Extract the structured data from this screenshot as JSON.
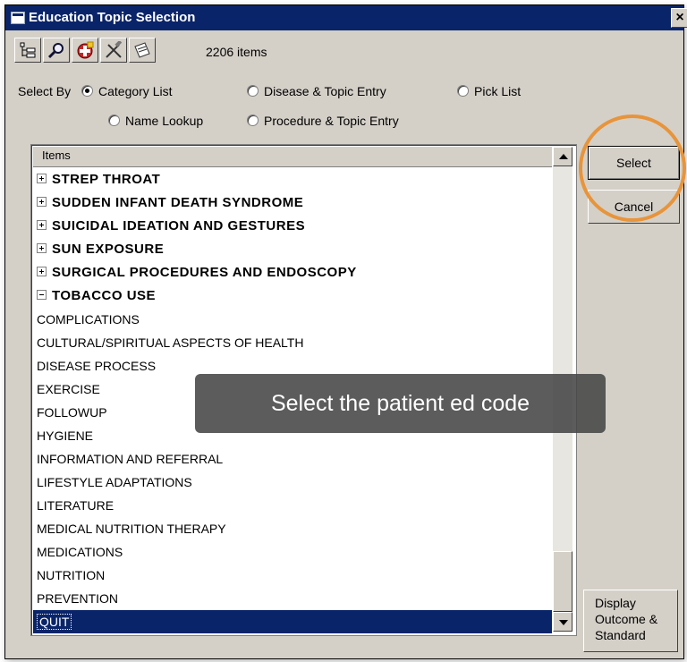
{
  "window": {
    "title": "Education Topic Selection",
    "close_label": "×"
  },
  "toolbar": {
    "buttons": [
      "tree-icon",
      "magnifier-icon",
      "add-favorite-icon",
      "tools-icon",
      "note-icon"
    ],
    "count_label": "2206 items"
  },
  "select_by": {
    "label": "Select By",
    "options": [
      "Category List",
      "Disease & Topic Entry",
      "Pick List",
      "Name Lookup",
      "Procedure & Topic Entry"
    ],
    "selected": "Category List"
  },
  "list": {
    "header": "Items",
    "groups": [
      {
        "label": "STREP THROAT",
        "expanded": false
      },
      {
        "label": "SUDDEN INFANT DEATH SYNDROME",
        "expanded": false
      },
      {
        "label": "SUICIDAL IDEATION AND GESTURES",
        "expanded": false
      },
      {
        "label": "SUN EXPOSURE",
        "expanded": false
      },
      {
        "label": "SURGICAL PROCEDURES AND ENDOSCOPY",
        "expanded": false
      },
      {
        "label": "TOBACCO USE",
        "expanded": true
      }
    ],
    "children": [
      "COMPLICATIONS",
      "CULTURAL/SPIRITUAL ASPECTS OF HEALTH",
      "DISEASE PROCESS",
      "EXERCISE",
      "FOLLOWUP",
      "HYGIENE",
      "INFORMATION AND REFERRAL",
      "LIFESTYLE ADAPTATIONS",
      "LITERATURE",
      "MEDICAL NUTRITION THERAPY",
      "MEDICATIONS",
      "NUTRITION",
      "PREVENTION",
      "QUIT"
    ],
    "selected_item": "QUIT"
  },
  "buttons": {
    "select": "Select",
    "cancel": "Cancel",
    "display_line1": "Display",
    "display_line2": "Outcome &",
    "display_line3": "Standard"
  },
  "tooltip": "Select the patient ed code",
  "colors": {
    "titlebar": "#0a246a",
    "face": "#d4d0c8",
    "highlight_ring": "#e8943a",
    "selection": "#0a246a"
  }
}
